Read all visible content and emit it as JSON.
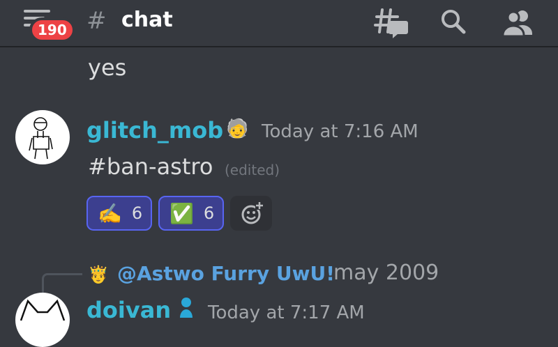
{
  "header": {
    "notification_count": "190",
    "hash": "#",
    "channel_name": "chat"
  },
  "messages": [
    {
      "text": "yes"
    },
    {
      "username": "glitch_mob",
      "timestamp": "Today at 7:16 AM",
      "text": "#ban-astro",
      "edited_label": "(edited)",
      "reactions": [
        {
          "emoji": "✍️",
          "count": "6"
        },
        {
          "emoji": "✅",
          "count": "6"
        }
      ]
    },
    {
      "reply_to": "@Astwo Furry UwU!",
      "reply_text": "may 2009",
      "username": "doivan",
      "timestamp": "Today at 7:17 AM"
    }
  ],
  "colors": {
    "background": "#36393f",
    "username": "#3ab8d4",
    "badge": "#ed4245",
    "reaction_border": "#5865f2"
  }
}
